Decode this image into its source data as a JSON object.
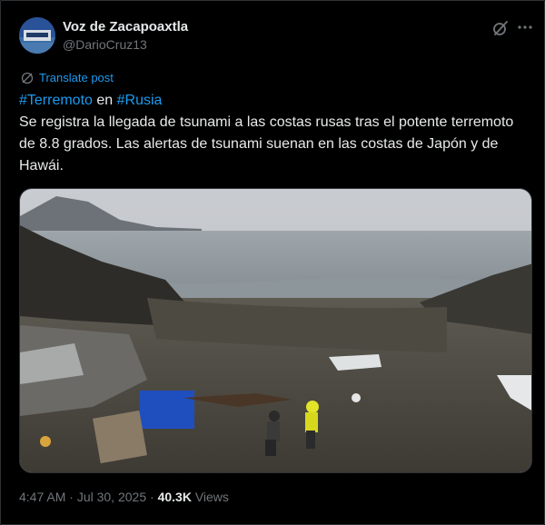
{
  "author": {
    "name": "Voz de Zacapoaxtla",
    "handle": "@DarioCruz13"
  },
  "translate": {
    "label": "Translate post"
  },
  "post": {
    "hashtag1": "#Terremoto",
    "connector": " en ",
    "hashtag2": "#Rusia",
    "text": "Se registra la llegada de tsunami a las costas rusas tras el potente terremoto de 8.8 grados. Las alertas de tsunami suenan en las costas de Japón y de Hawái."
  },
  "meta": {
    "time": "4:47 AM",
    "separator1": " · ",
    "date": "Jul 30, 2025",
    "separator2": " · ",
    "views_count": "40.3K",
    "views_label": " Views"
  },
  "icons": {
    "grok": "grok-icon",
    "more": "more-icon",
    "translate": "translate-icon"
  },
  "colors": {
    "accent": "#1d9bf0",
    "text": "#e7e9ea",
    "muted": "#71767b",
    "background": "#000000"
  }
}
